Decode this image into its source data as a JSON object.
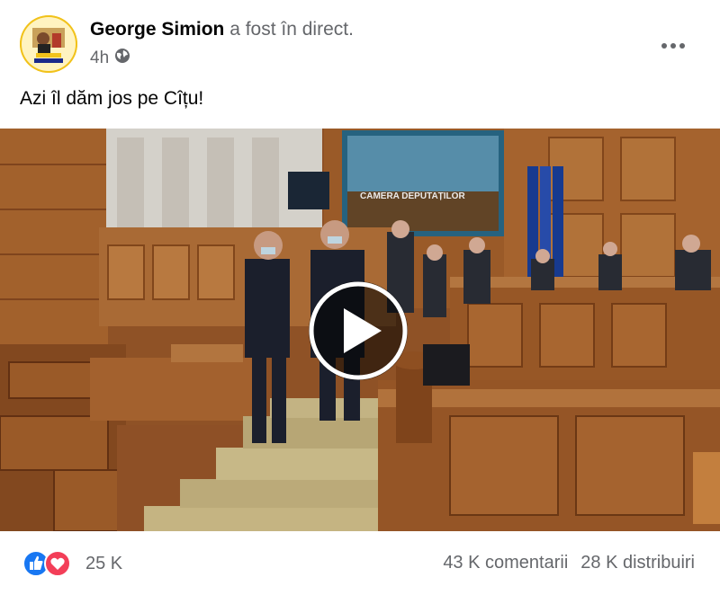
{
  "post": {
    "author": "George Simion",
    "action_text": "a fost în direct.",
    "time": "4h",
    "privacy_icon": "globe-icon",
    "caption": "Azi îl dăm jos pe Cîțu!",
    "more_icon": "more-options-icon",
    "avatar_text": "AUR pentru ROMÂNIA"
  },
  "video": {
    "play_icon": "play-icon",
    "screen_text": "CAMERA DEPUTAȚILOR"
  },
  "footer": {
    "reaction_icons": [
      "like-icon",
      "love-icon"
    ],
    "reactions_count": "25 K",
    "comments": "43 K comentarii",
    "shares": "28 K distribuiri"
  },
  "colors": {
    "like_blue": "#1877f2",
    "love_red": "#f33e58",
    "meta_gray": "#65676b"
  }
}
